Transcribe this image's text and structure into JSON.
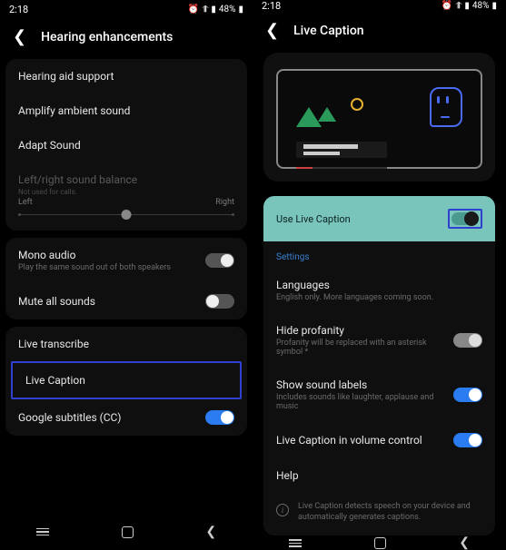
{
  "status": {
    "time": "2:18",
    "battery": "48%"
  },
  "left": {
    "title": "Hearing enhancements",
    "groups": [
      {
        "items": [
          {
            "title": "Hearing aid support"
          },
          {
            "title": "Amplify ambient sound"
          },
          {
            "title": "Adapt Sound"
          }
        ],
        "balance": {
          "title": "Left/right sound balance",
          "sub": "Not used for calls.",
          "left": "Left",
          "right": "Right"
        }
      },
      {
        "items": [
          {
            "title": "Mono audio",
            "sub": "Play the same sound out of both speakers",
            "toggle": true,
            "on": false,
            "pos": "right"
          },
          {
            "title": "Mute all sounds",
            "toggle": true,
            "on": false,
            "pos": "left"
          }
        ]
      },
      {
        "items": [
          {
            "title": "Live transcribe"
          },
          {
            "title": "Live Caption",
            "highlighted": true
          },
          {
            "title": "Google subtitles (CC)",
            "toggle": true,
            "on": true
          }
        ]
      }
    ]
  },
  "right": {
    "title": "Live Caption",
    "useLabel": "Use Live Caption",
    "settingsHeader": "Settings",
    "items": [
      {
        "title": "Languages",
        "sub": "English only. More languages coming soon."
      },
      {
        "title": "Hide profanity",
        "sub": "Profanity will be replaced with an asterisk symbol *",
        "toggle": true,
        "variant": "grey"
      },
      {
        "title": "Show sound labels",
        "sub": "Includes sounds like laughter, applause and music",
        "toggle": true,
        "variant": "blue"
      },
      {
        "title": "Live Caption in volume control",
        "toggle": true,
        "variant": "blue"
      },
      {
        "title": "Help"
      }
    ],
    "info": "Live Caption detects speech on your device and automatically generates captions."
  }
}
